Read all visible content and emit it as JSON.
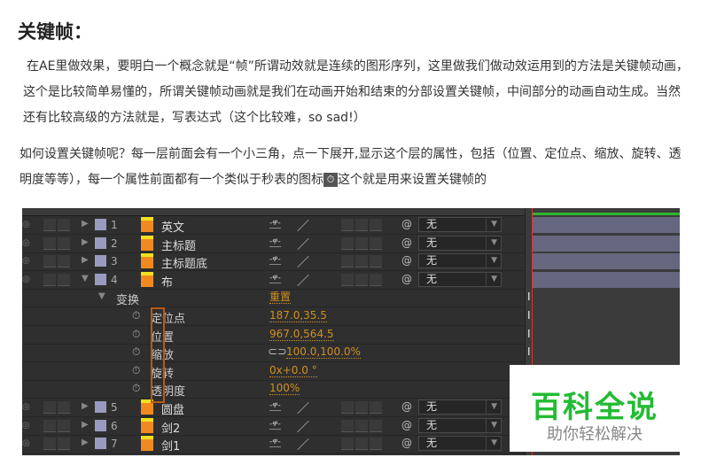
{
  "title": "关键帧：",
  "para1": "在AE里做效果，要明白一个概念就是“帧”所谓动效就是连续的图形序列，这里做我们做动效运用到的方法是关键帧动画，这个是比较简单易懂的，所谓关键帧动画就是我们在动画开始和结束的分部设置关键帧，中间部分的动画自动生成。当然还有比较高级的方法就是，写表达式（这个比较难，so sad!）",
  "para2a": "如何设置关键帧呢？每一层前面会有一个小三角，点一下展开,显示这个层的属性，包括（位置、定位点、缩放、旋转、透明度等等），每一个属性前面都有一个类似于秒表的图标",
  "para2b": "这个就是用来设置关键帧的",
  "layers_top": [
    {
      "num": "1",
      "name": "英文",
      "mode": "无"
    },
    {
      "num": "2",
      "name": "主标题",
      "mode": "无"
    },
    {
      "num": "3",
      "name": "主标题底",
      "mode": "无"
    },
    {
      "num": "4",
      "name": "布",
      "mode": "无",
      "open": true
    }
  ],
  "transform": {
    "label": "变换",
    "reset": "重置"
  },
  "props": [
    {
      "name": "定位点",
      "value": "187.0,35.5"
    },
    {
      "name": "位置",
      "value": "967.0,564.5"
    },
    {
      "name": "缩放",
      "value": "100.0,100.0%",
      "link": true
    },
    {
      "name": "旋转",
      "value": "0x+0.0 °"
    },
    {
      "name": "透明度",
      "value": "100%"
    }
  ],
  "layers_bottom": [
    {
      "num": "5",
      "name": "圆盘",
      "mode": "无"
    },
    {
      "num": "6",
      "name": "剑2",
      "mode": "无"
    },
    {
      "num": "7",
      "name": "剑1",
      "mode": "无"
    }
  ],
  "watermark": {
    "main": "百科全说",
    "sub": "助你轻松解决"
  }
}
